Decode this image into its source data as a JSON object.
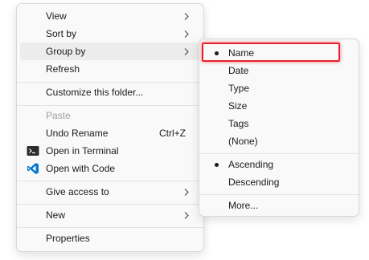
{
  "context_menu": {
    "items": [
      {
        "label": "View"
      },
      {
        "label": "Sort by"
      },
      {
        "label": "Group by"
      },
      {
        "label": "Refresh"
      },
      {
        "label": "Customize this folder..."
      },
      {
        "label": "Paste"
      },
      {
        "label": "Undo Rename",
        "shortcut": "Ctrl+Z"
      },
      {
        "label": "Open in Terminal",
        "icon": "terminal-icon"
      },
      {
        "label": "Open with Code",
        "icon": "vscode-icon"
      },
      {
        "label": "Give access to"
      },
      {
        "label": "New"
      },
      {
        "label": "Properties"
      }
    ]
  },
  "group_by_submenu": {
    "items": [
      {
        "label": "Name",
        "selected": true
      },
      {
        "label": "Date"
      },
      {
        "label": "Type"
      },
      {
        "label": "Size"
      },
      {
        "label": "Tags"
      },
      {
        "label": "(None)"
      },
      {
        "label": "Ascending",
        "selected": true
      },
      {
        "label": "Descending"
      },
      {
        "label": "More..."
      }
    ]
  },
  "colors": {
    "highlight_border": "#e8222c",
    "vscode_blue": "#0078d4",
    "terminal_dark": "#2b2b2b"
  }
}
